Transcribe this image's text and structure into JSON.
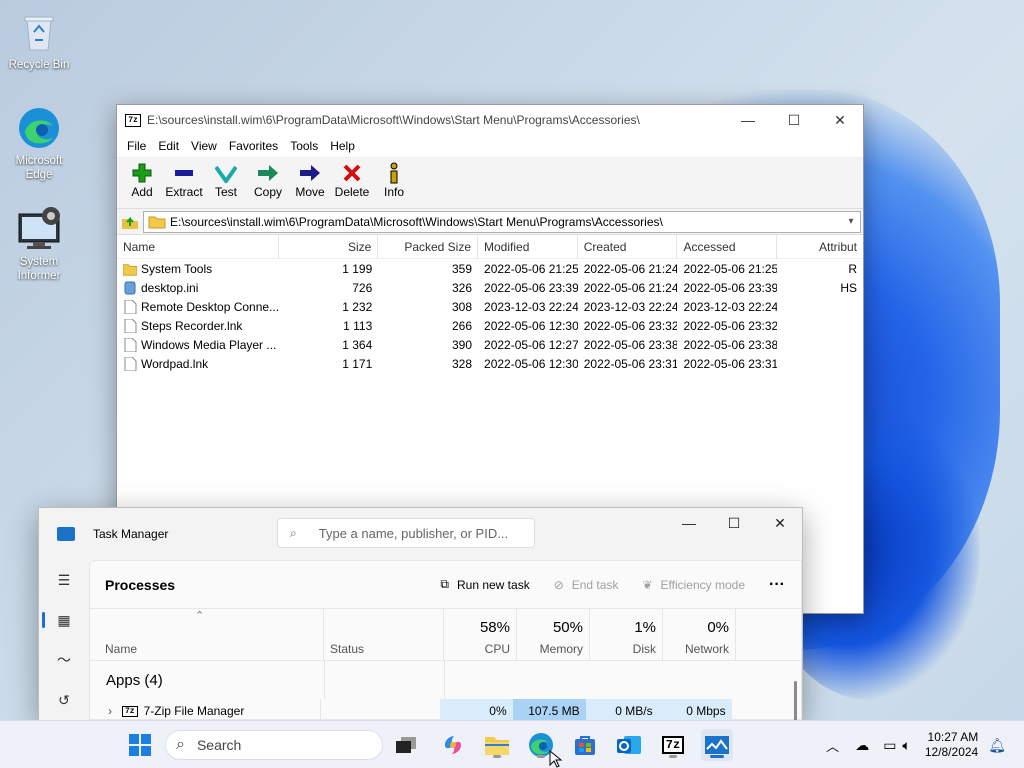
{
  "desktop": {
    "icons": [
      {
        "label": "Recycle Bin",
        "icon": "recycle-bin-icon"
      },
      {
        "label": "Microsoft Edge",
        "icon": "edge-icon"
      },
      {
        "label": "System Informer",
        "icon": "system-informer-icon"
      }
    ]
  },
  "sevenzip": {
    "title": "E:\\sources\\install.wim\\6\\ProgramData\\Microsoft\\Windows\\Start Menu\\Programs\\Accessories\\",
    "logo": "7z",
    "menu": [
      "File",
      "Edit",
      "View",
      "Favorites",
      "Tools",
      "Help"
    ],
    "toolbar": [
      {
        "label": "Add",
        "icon": "add-icon",
        "color": "#1a9e1a"
      },
      {
        "label": "Extract",
        "icon": "extract-icon",
        "color": "#1b1b9e"
      },
      {
        "label": "Test",
        "icon": "test-icon",
        "color": "#1aa9a9"
      },
      {
        "label": "Copy",
        "icon": "copy-icon",
        "color": "#1a8a5a"
      },
      {
        "label": "Move",
        "icon": "move-icon",
        "color": "#1b1b8a"
      },
      {
        "label": "Delete",
        "icon": "delete-icon",
        "color": "#d01010"
      },
      {
        "label": "Info",
        "icon": "info-icon",
        "color": "#c8a400"
      }
    ],
    "address": "E:\\sources\\install.wim\\6\\ProgramData\\Microsoft\\Windows\\Start Menu\\Programs\\Accessories\\",
    "columns": [
      "Name",
      "Size",
      "Packed Size",
      "Modified",
      "Created",
      "Accessed",
      "Attribut"
    ],
    "rows": [
      {
        "name": "System Tools",
        "type": "folder",
        "size": "1 199",
        "packed": "359",
        "modified": "2022-05-06 21:25",
        "created": "2022-05-06 21:24",
        "accessed": "2022-05-06 21:25",
        "attr": "R"
      },
      {
        "name": "desktop.ini",
        "type": "ini",
        "size": "726",
        "packed": "326",
        "modified": "2022-05-06 23:39",
        "created": "2022-05-06 21:24",
        "accessed": "2022-05-06 23:39",
        "attr": "HS"
      },
      {
        "name": "Remote Desktop Conne...",
        "type": "file",
        "size": "1 232",
        "packed": "308",
        "modified": "2023-12-03 22:24",
        "created": "2023-12-03 22:24",
        "accessed": "2023-12-03 22:24",
        "attr": ""
      },
      {
        "name": "Steps Recorder.lnk",
        "type": "file",
        "size": "1 113",
        "packed": "266",
        "modified": "2022-05-06 12:30",
        "created": "2022-05-06 23:32",
        "accessed": "2022-05-06 23:32",
        "attr": ""
      },
      {
        "name": "Windows Media Player ...",
        "type": "file",
        "size": "1 364",
        "packed": "390",
        "modified": "2022-05-06 12:27",
        "created": "2022-05-06 23:38",
        "accessed": "2022-05-06 23:38",
        "attr": ""
      },
      {
        "name": "Wordpad.lnk",
        "type": "file",
        "size": "1 171",
        "packed": "328",
        "modified": "2022-05-06 12:30",
        "created": "2022-05-06 23:31",
        "accessed": "2022-05-06 23:31",
        "attr": ""
      }
    ]
  },
  "taskmanager": {
    "title": "Task Manager",
    "search_placeholder": "Type a name, publisher, or PID...",
    "page_title": "Processes",
    "run_new_task": "Run new task",
    "end_task": "End task",
    "efficiency_mode": "Efficiency mode",
    "col_name": "Name",
    "col_status": "Status",
    "cpu": {
      "pct": "58%",
      "label": "CPU"
    },
    "memory": {
      "pct": "50%",
      "label": "Memory"
    },
    "disk": {
      "pct": "1%",
      "label": "Disk"
    },
    "network": {
      "pct": "0%",
      "label": "Network"
    },
    "group": "Apps (4)",
    "process": {
      "name": "7-Zip File Manager",
      "cpu": "0%",
      "memory": "107.5 MB",
      "disk": "0 MB/s",
      "network": "0 Mbps"
    }
  },
  "taskbar": {
    "search": "Search",
    "time": "10:27 AM",
    "date": "12/8/2024"
  }
}
